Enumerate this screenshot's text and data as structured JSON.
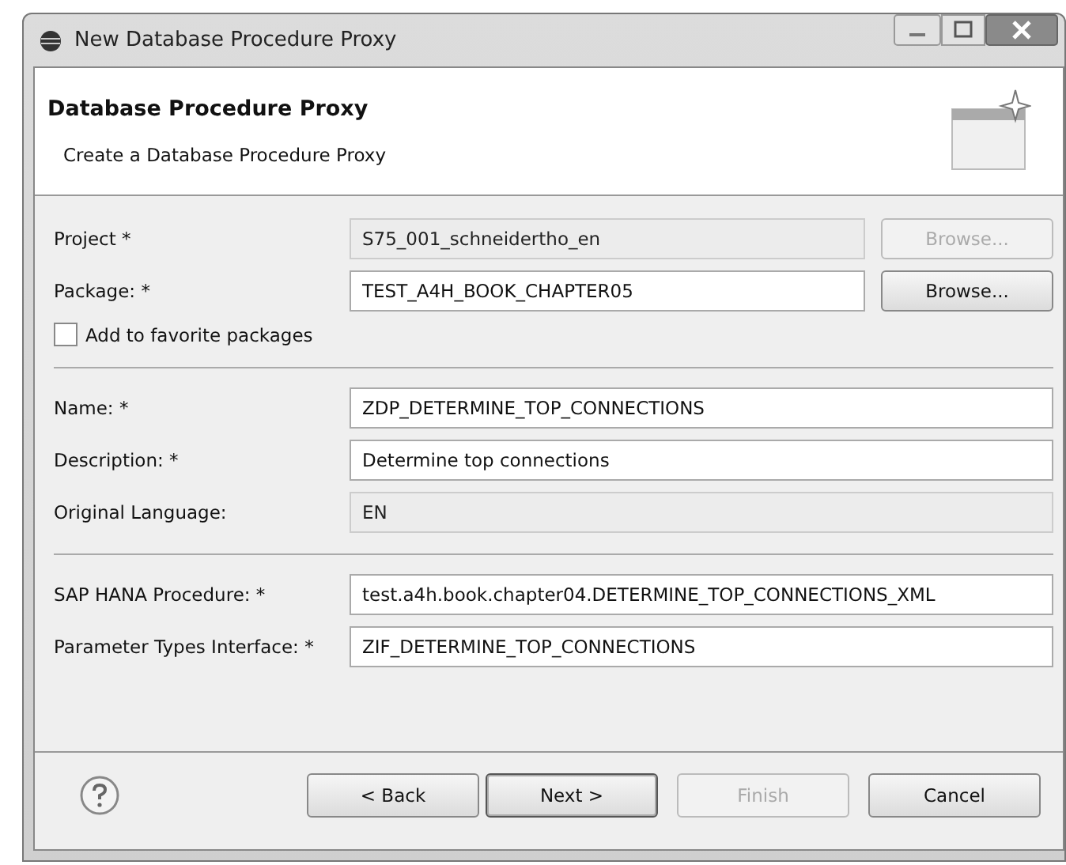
{
  "window": {
    "title": "New Database Procedure Proxy"
  },
  "header": {
    "title": "Database Procedure Proxy",
    "subtitle": "Create a Database Procedure Proxy"
  },
  "sections": [
    {
      "fields": [
        {
          "label": "Project *",
          "value": "S75_001_schneidertho_en",
          "disabled": true,
          "browse": {
            "label": "Browse...",
            "disabled": true
          }
        },
        {
          "label": "Package: *",
          "value": "TEST_A4H_BOOK_CHAPTER05",
          "disabled": false,
          "browse": {
            "label": "Browse...",
            "disabled": false
          }
        }
      ],
      "checkbox": {
        "label": "Add to favorite packages",
        "checked": false
      }
    },
    {
      "fields": [
        {
          "label": "Name: *",
          "value": "ZDP_DETERMINE_TOP_CONNECTIONS",
          "disabled": false
        },
        {
          "label": "Description: *",
          "value": "Determine top connections",
          "disabled": false
        },
        {
          "label": "Original Language:",
          "value": "EN",
          "disabled": true
        }
      ]
    },
    {
      "fields": [
        {
          "label": "SAP HANA Procedure: *",
          "value": "test.a4h.book.chapter04.DETERMINE_TOP_CONNECTIONS_XML",
          "disabled": false
        },
        {
          "label": "Parameter Types Interface: *",
          "value": "ZIF_DETERMINE_TOP_CONNECTIONS",
          "disabled": false
        }
      ]
    }
  ],
  "buttons": [
    {
      "label": "< Back",
      "disabled": false,
      "default": false
    },
    {
      "label": "Next >",
      "disabled": false,
      "default": true
    },
    {
      "label": "Finish",
      "disabled": true,
      "default": false
    },
    {
      "label": "Cancel",
      "disabled": false,
      "default": false
    }
  ]
}
